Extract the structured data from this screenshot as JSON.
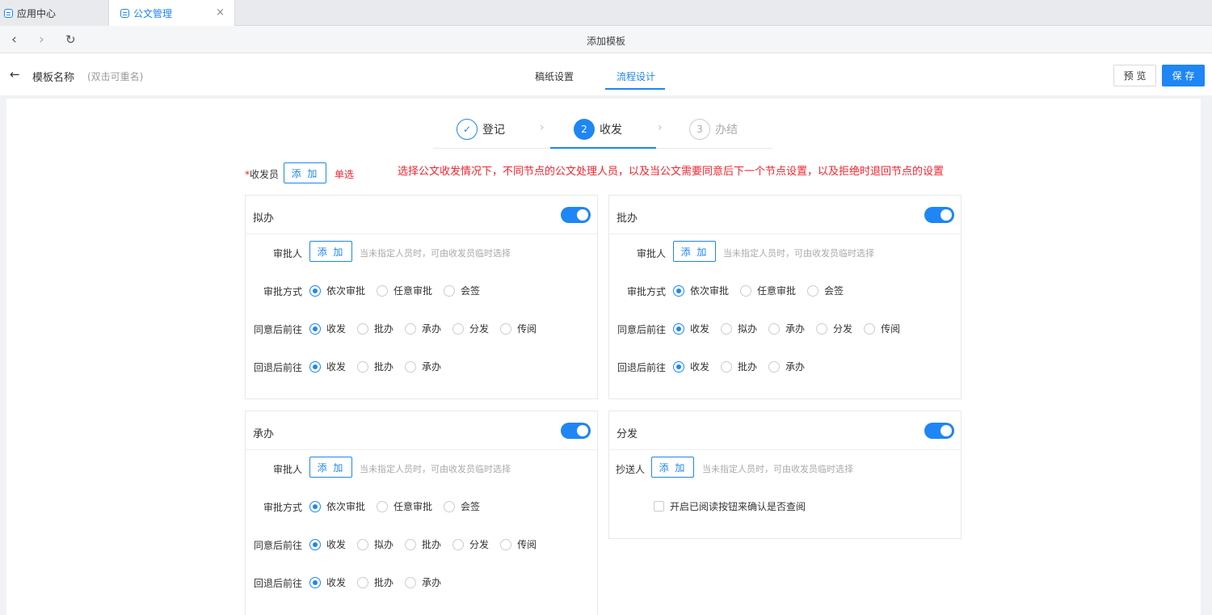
{
  "browser": {
    "tabs": [
      {
        "label": "应用中心",
        "active": false
      },
      {
        "label": "公文管理",
        "active": true
      }
    ],
    "close_glyph": "×",
    "nav_title": "添加模板"
  },
  "header": {
    "template_name": "模板名称",
    "template_hint": "(双击可重名)",
    "tabs": [
      {
        "label": "稿纸设置",
        "active": false
      },
      {
        "label": "流程设计",
        "active": true
      }
    ],
    "preview_label": "预 览",
    "save_label": "保 存"
  },
  "steps": [
    {
      "marker": "✓",
      "label": "登记",
      "state": "done"
    },
    {
      "marker": "2",
      "label": "收发",
      "state": "active"
    },
    {
      "marker": "3",
      "label": "办结",
      "state": "todo"
    }
  ],
  "sender": {
    "required_mark": "*",
    "label": "收发员",
    "add_label": "添 加",
    "single_label": "单选",
    "notice": "选择公文收发情况下，不同节点的公文处理人员，以及当公文需要同意后下一个节点设置，以及拒绝时退回节点的设置"
  },
  "cards": [
    {
      "title": "拟办",
      "enabled": true,
      "approver_label": "审批人",
      "add_label": "添 加",
      "hint": "当未指定人员时，可由收发员临时选择",
      "method_label": "审批方式",
      "methods": [
        "依次审批",
        "任意审批",
        "会签"
      ],
      "method_selected": 0,
      "agree_label": "同意后前往",
      "agree_options": [
        "收发",
        "批办",
        "承办",
        "分发",
        "传阅"
      ],
      "agree_selected": 0,
      "reject_label": "回退后前往",
      "reject_options": [
        "收发",
        "批办",
        "承办"
      ],
      "reject_selected": 0
    },
    {
      "title": "批办",
      "enabled": true,
      "approver_label": "审批人",
      "add_label": "添 加",
      "hint": "当未指定人员时，可由收发员临时选择",
      "method_label": "审批方式",
      "methods": [
        "依次审批",
        "任意审批",
        "会签"
      ],
      "method_selected": 0,
      "agree_label": "同意后前往",
      "agree_options": [
        "收发",
        "拟办",
        "承办",
        "分发",
        "传阅"
      ],
      "agree_selected": 0,
      "reject_label": "回退后前往",
      "reject_options": [
        "收发",
        "批办",
        "承办"
      ],
      "reject_selected": 0
    },
    {
      "title": "承办",
      "enabled": true,
      "approver_label": "审批人",
      "add_label": "添 加",
      "hint": "当未指定人员时，可由收发员临时选择",
      "method_label": "审批方式",
      "methods": [
        "依次审批",
        "任意审批",
        "会签"
      ],
      "method_selected": 0,
      "agree_label": "同意后前往",
      "agree_options": [
        "收发",
        "拟办",
        "批办",
        "分发",
        "传阅"
      ],
      "agree_selected": 0,
      "reject_label": "回退后前往",
      "reject_options": [
        "收发",
        "批办",
        "承办"
      ],
      "reject_selected": 0
    },
    {
      "title": "分发",
      "enabled": true,
      "cc_label": "抄送人",
      "add_label": "添 加",
      "hint": "当未指定人员时，可由收发员临时选择",
      "checkbox_label": "开启已阅读按钮来确认是否查阅",
      "checkbox_checked": false
    }
  ],
  "colors": {
    "primary": "#1e86f5",
    "danger": "#f5222d"
  }
}
